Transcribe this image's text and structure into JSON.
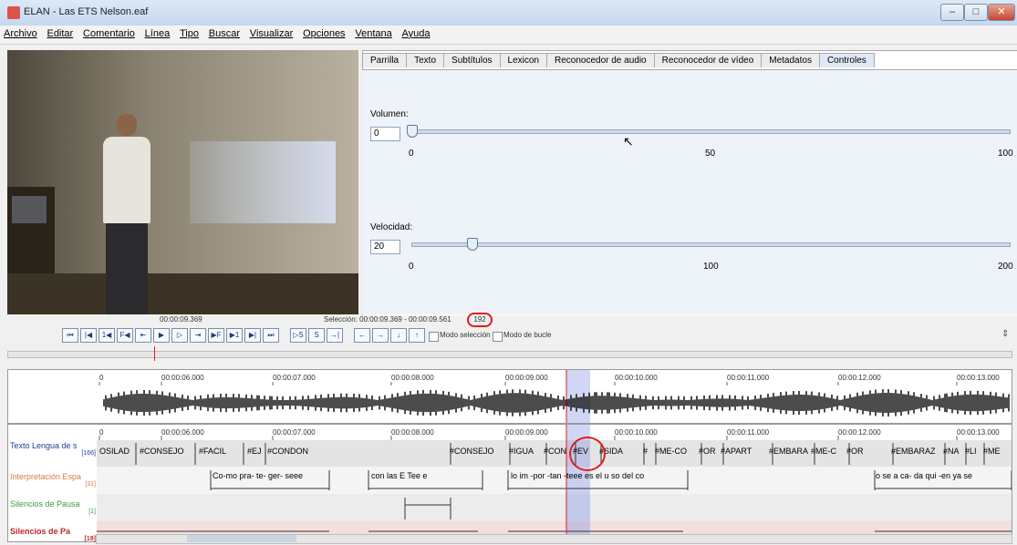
{
  "window": {
    "title": "ELAN - Las ETS Nelson.eaf",
    "min": "–",
    "max": "□",
    "close": "✕"
  },
  "menu": [
    "Archivo",
    "Editar",
    "Comentario",
    "Línea",
    "Tipo",
    "Buscar",
    "Visualizar",
    "Opciones",
    "Ventana",
    "Ayuda"
  ],
  "tabs": [
    "Parrilla",
    "Texto",
    "Subtítulos",
    "Lexicon",
    "Reconocedor de audio",
    "Reconocedor de vídeo",
    "Metadatos",
    "Controles"
  ],
  "controls": {
    "volume": {
      "label": "Volumen:",
      "value": "0",
      "ticks": [
        "0",
        "50",
        "100"
      ],
      "level": 0
    },
    "speed": {
      "label": "Velocidad:",
      "value": "20",
      "ticks": [
        "0",
        "100",
        "200"
      ],
      "level": 20
    }
  },
  "player": {
    "time": "00:00:09.369",
    "selection": "Selección: 00:00:09.369 - 00:00:09.561",
    "selection_len": "192",
    "selection_mode": "Modo selección",
    "loop_mode": "Modo de bucle"
  },
  "waveform": {
    "times": [
      "0",
      "00:00:06.000",
      "00:00:07.000",
      "00:00:08.000",
      "00:00:09.000",
      "00:00:10.000",
      "00:00:11.000",
      "00:00:12.000",
      "00:00:13.000"
    ]
  },
  "timeline": {
    "times": [
      "0",
      "00:00:06.000",
      "00:00:07.000",
      "00:00:08.000",
      "00:00:09.000",
      "00:00:10.000",
      "00:00:11.000",
      "00:00:12.000",
      "00:00:13.000"
    ]
  },
  "tiers": [
    {
      "name": "Texto Lengua de s",
      "count": "[166]",
      "color": "#1f3d9a"
    },
    {
      "name": "Interpretación Espa",
      "count": "[31]",
      "color": "#d97a48"
    },
    {
      "name": "Silencios de Pausa",
      "count": "[1]",
      "color": "#3f9a3f"
    },
    {
      "name": "Silencios de Pa",
      "count": "[19]",
      "color": "#c0282b"
    }
  ],
  "row1": [
    "OSILAD",
    "#CONSEJO",
    "#FACIL",
    "#EJ",
    "#CONDON",
    "#CONSEJO",
    "#IGUA",
    "#CON",
    "#EV",
    "#SIDA",
    "#",
    "#ME-CO",
    "#OR",
    "#APART",
    "#EMBARA",
    "#ME-C",
    "#OR",
    "#EMBARAZ",
    "#NA",
    "#LI",
    "#ME"
  ],
  "row2": [
    "Co-mo pra- te- ger- seee",
    "con  las   E  Tee      e",
    "lo im -por -tan   -teee  es el u so del co",
    "o  se  a    ca- da qui -en  ya se"
  ]
}
